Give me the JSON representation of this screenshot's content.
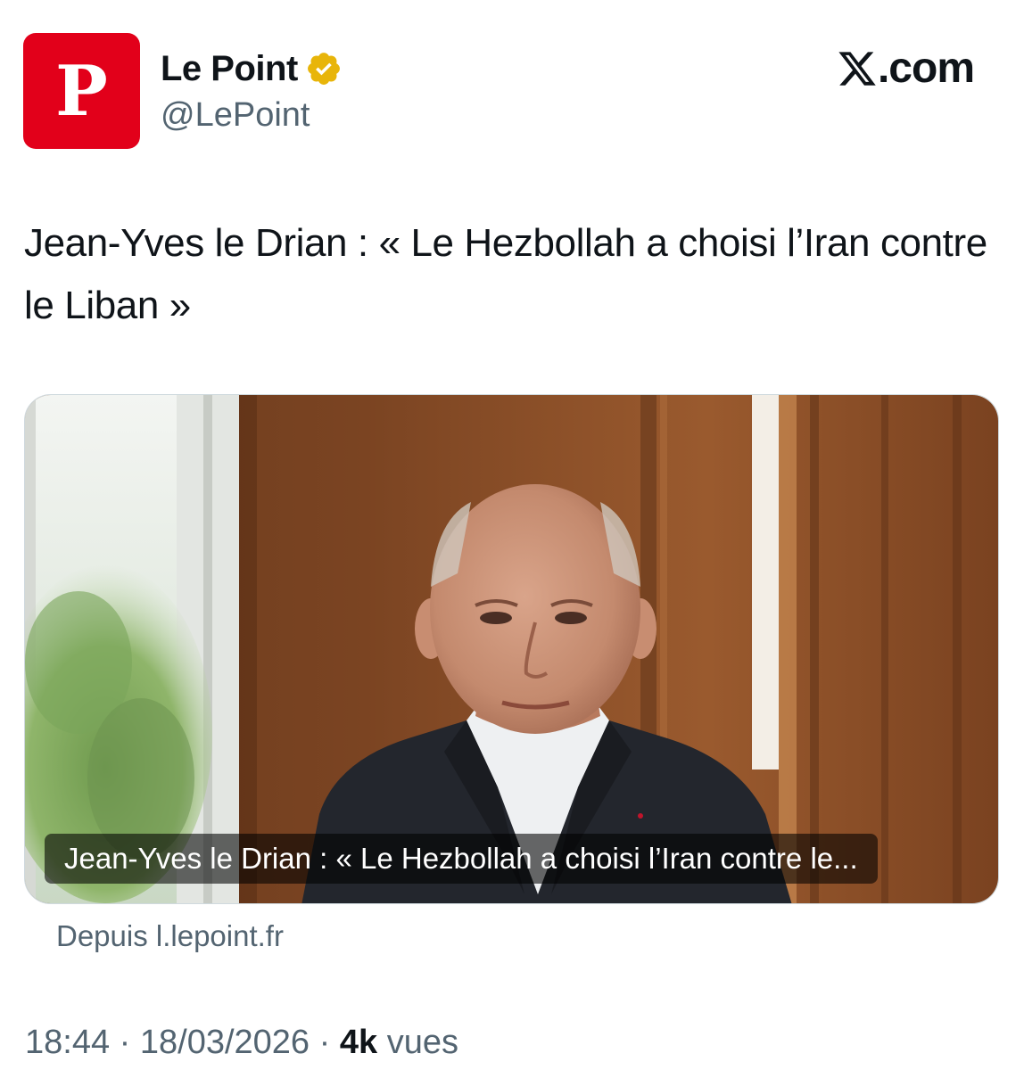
{
  "author": {
    "avatar_letter": "P",
    "avatar_color": "#e2001a",
    "name": "Le Point",
    "verified_icon": "verified-badge-gold",
    "handle": "@LePoint"
  },
  "brand": {
    "icon": "x-logo-icon",
    "text": ".com"
  },
  "tweet": {
    "text": "Jean-Yves le Drian : « Le Hezbollah a choisi l’Iran contre le Liban »"
  },
  "card": {
    "caption": "Jean-Yves le Drian : « Le Hezbollah a choisi l’Iran contre le...",
    "source": "Depuis l.lepoint.fr"
  },
  "meta": {
    "time": "18:44",
    "separator": "·",
    "date": "18/03/2026",
    "views_count": "4k",
    "views_label": "vues"
  },
  "colors": {
    "text_primary": "#0f1419",
    "text_secondary": "#536471",
    "verified_gold": "#e8b50a"
  }
}
